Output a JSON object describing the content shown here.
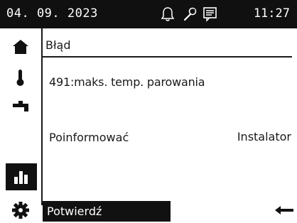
{
  "statusbar": {
    "date": "04. 09. 2023",
    "time": "11:27",
    "icons": [
      "bell-icon",
      "wrench-icon",
      "message-icon"
    ]
  },
  "sidebar": {
    "items": [
      {
        "icon": "home-icon",
        "active": false
      },
      {
        "icon": "thermometer-icon",
        "active": false
      },
      {
        "icon": "tap-icon",
        "active": false
      },
      {
        "icon": "chart-icon",
        "active": true
      },
      {
        "icon": "gear-icon",
        "active": false
      }
    ]
  },
  "main": {
    "title": "Błąd",
    "error_text": "491:maks. temp. parowania",
    "notify_label": "Poinformować",
    "notify_value": "Instalator",
    "confirm_label": "Potwierdź"
  },
  "colors": {
    "background": "#ffffff",
    "bar": "#101010",
    "text": "#1a1a1a",
    "active": "#111111"
  }
}
